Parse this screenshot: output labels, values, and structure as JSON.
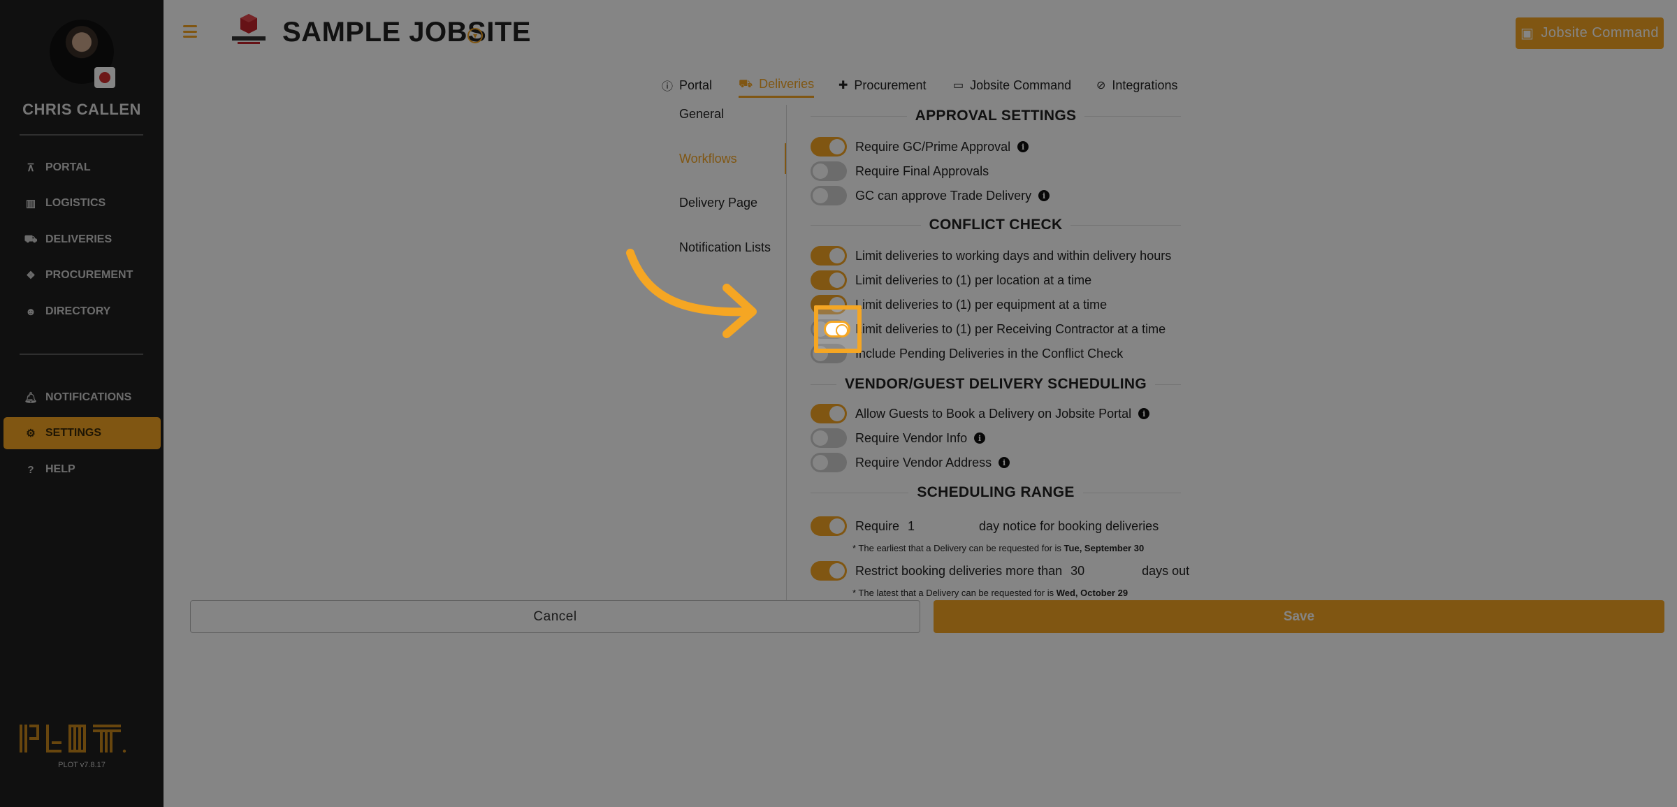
{
  "sidebar": {
    "user_name": "CHRIS CALLEN",
    "nav_top": [
      {
        "label": "PORTAL",
        "icon": "sitemap-icon"
      },
      {
        "label": "LOGISTICS",
        "icon": "map-icon"
      },
      {
        "label": "DELIVERIES",
        "icon": "truck-icon"
      },
      {
        "label": "PROCUREMENT",
        "icon": "cubes-icon"
      },
      {
        "label": "DIRECTORY",
        "icon": "users-icon"
      }
    ],
    "nav_bottom": [
      {
        "label": "NOTIFICATIONS",
        "icon": "bell-icon"
      },
      {
        "label": "SETTINGS",
        "icon": "gear-icon",
        "active": true
      },
      {
        "label": "HELP",
        "icon": "question-icon"
      }
    ],
    "version": "PLOT v7.8.17"
  },
  "header": {
    "project_title": "SAMPLE JOBSITE",
    "jobsite_command_label": "Jobsite Command"
  },
  "tabs": [
    {
      "label": "Portal",
      "icon": "info-icon"
    },
    {
      "label": "Deliveries",
      "icon": "truck-icon",
      "active": true
    },
    {
      "label": "Procurement",
      "icon": "puzzle-icon"
    },
    {
      "label": "Jobsite Command",
      "icon": "monitor-icon"
    },
    {
      "label": "Integrations",
      "icon": "link-icon"
    }
  ],
  "subnav": [
    {
      "label": "General"
    },
    {
      "label": "Workflows",
      "active": true
    },
    {
      "label": "Delivery Page"
    },
    {
      "label": "Notification Lists"
    }
  ],
  "settings": {
    "approval_title": "APPROVAL SETTINGS",
    "approval": [
      {
        "label": "Require GC/Prime Approval",
        "on": true,
        "info": true
      },
      {
        "label": "Require Final Approvals",
        "on": false,
        "info": false
      },
      {
        "label": "GC can approve Trade Delivery",
        "on": false,
        "info": true
      }
    ],
    "conflict_title": "CONFLICT CHECK",
    "conflict": [
      {
        "label": "Limit deliveries to working days and within delivery hours",
        "on": true
      },
      {
        "label": "Limit deliveries to (1) per location at a time",
        "on": true
      },
      {
        "label": "Limit deliveries to (1) per equipment at a time",
        "on": true
      },
      {
        "label": "Limit deliveries to (1) per Receiving Contractor at a time",
        "on": false
      },
      {
        "label": "Include Pending Deliveries in the Conflict Check",
        "on": false
      }
    ],
    "vendor_title": "VENDOR/GUEST DELIVERY SCHEDULING",
    "vendor": [
      {
        "label": "Allow Guests to Book a Delivery on Jobsite Portal",
        "on": true,
        "info": true
      },
      {
        "label": "Require Vendor Info",
        "on": false,
        "info": true
      },
      {
        "label": "Require Vendor Address",
        "on": false,
        "info": true
      }
    ],
    "range_title": "SCHEDULING RANGE",
    "range": {
      "notice_prefix": "Require",
      "notice_value": "1",
      "notice_suffix": "day notice for booking deliveries",
      "notice_on": true,
      "earliest_note": "* The earliest that a Delivery can be requested for is",
      "earliest_date": "Tue, September 30",
      "restrict_prefix": "Restrict booking deliveries more than",
      "restrict_value": "30",
      "restrict_suffix": "days out",
      "restrict_on": true,
      "latest_note": "* The latest that a Delivery can be requested for is",
      "latest_date": "Wed, October 29"
    }
  },
  "footer": {
    "cancel_label": "Cancel",
    "save_label": "Save"
  },
  "colors": {
    "accent": "#f5a623",
    "sidebar_bg": "#1f1f1f",
    "toggle_off": "#cfcfcf"
  }
}
